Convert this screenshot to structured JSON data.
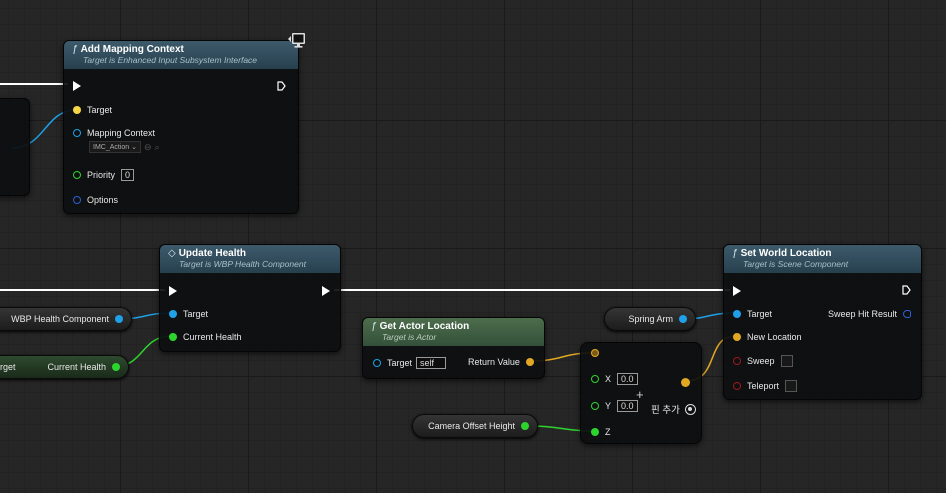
{
  "colors": {
    "object": "#1ea1e8",
    "float": "#2ed42e",
    "vector": "#e3a823",
    "bool": "#9c1a1a",
    "struct": "#2f5fd6",
    "exec": "#ffffff"
  },
  "add_mapping": {
    "title": "Add Mapping Context",
    "subtitle": "Target is Enhanced Input Subsystem Interface",
    "target": "Target",
    "mapping_context": "Mapping Context",
    "mapping_value": "IMC_Action",
    "priority": "Priority",
    "priority_value": "0",
    "options": "Options"
  },
  "update_health": {
    "title": "Update Health",
    "subtitle": "Target is WBP Health Component",
    "target": "Target",
    "current_health": "Current Health"
  },
  "get_actor": {
    "title": "Get Actor Location",
    "subtitle": "Target is Actor",
    "target": "Target",
    "target_value": "self",
    "return_value": "Return Value"
  },
  "set_world": {
    "title": "Set World Location",
    "subtitle": "Target is Scene Component",
    "target": "Target",
    "new_location": "New Location",
    "sweep": "Sweep",
    "teleport": "Teleport",
    "sweep_hit": "Sweep Hit Result"
  },
  "make_vector": {
    "x": "X",
    "x_value": "0.0",
    "y": "Y",
    "y_value": "0.0",
    "z": "Z",
    "add_pin": "핀 추가"
  },
  "vars": {
    "wbp_health": "WBP Health Component",
    "current_health": "Current Health",
    "current_health_prefix": "arget",
    "spring_arm": "Spring Arm",
    "camera_offset": "Camera Offset Height"
  },
  "icons": {
    "function": "ƒ",
    "event": "◇",
    "display": "monitor-icon"
  }
}
